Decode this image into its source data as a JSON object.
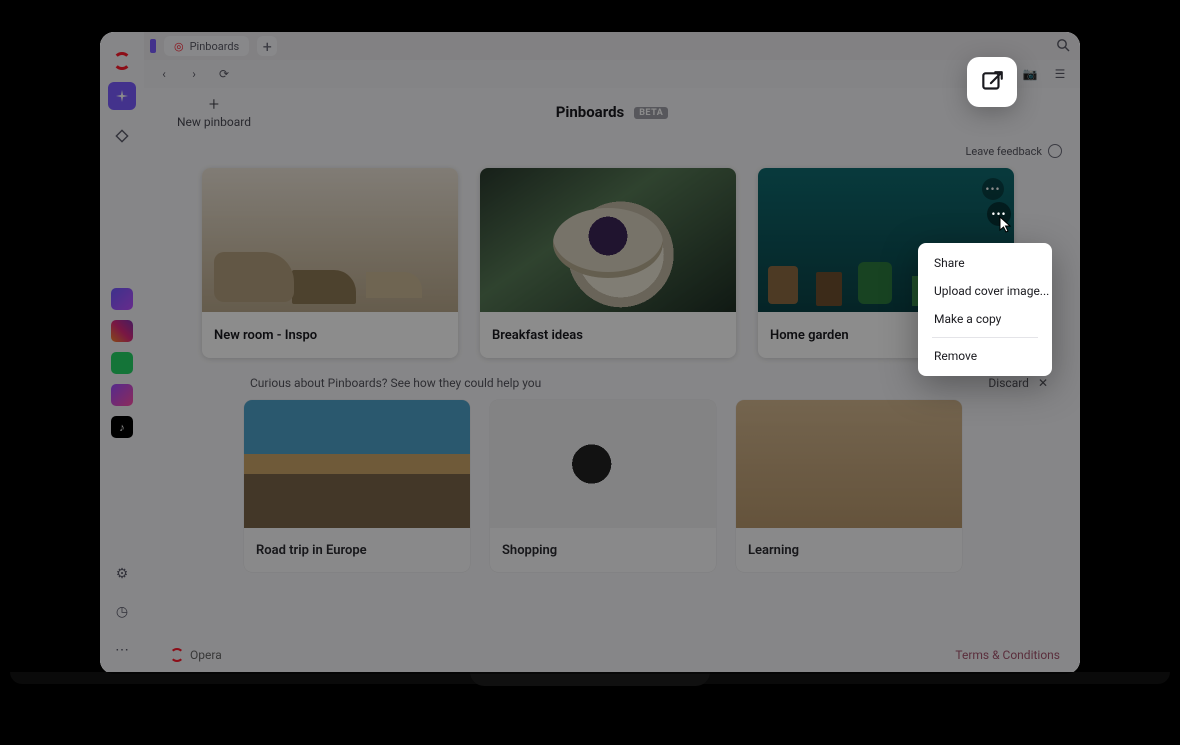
{
  "tab": {
    "label": "Pinboards"
  },
  "page": {
    "title": "Pinboards",
    "badge": "BETA",
    "newPinboard": "New pinboard",
    "feedback": "Leave feedback"
  },
  "cards": [
    {
      "title": "New room - Inspo"
    },
    {
      "title": "Breakfast ideas"
    },
    {
      "title": "Home garden"
    }
  ],
  "teaser": {
    "prompt": "Curious about Pinboards? See how they could help you",
    "discard": "Discard",
    "items": [
      {
        "title": "Road trip in Europe"
      },
      {
        "title": "Shopping"
      },
      {
        "title": "Learning"
      }
    ]
  },
  "contextMenu": {
    "share": "Share",
    "upload": "Upload cover image...",
    "copy": "Make a copy",
    "remove": "Remove"
  },
  "footer": {
    "brand": "Opera",
    "terms": "Terms & Conditions"
  }
}
